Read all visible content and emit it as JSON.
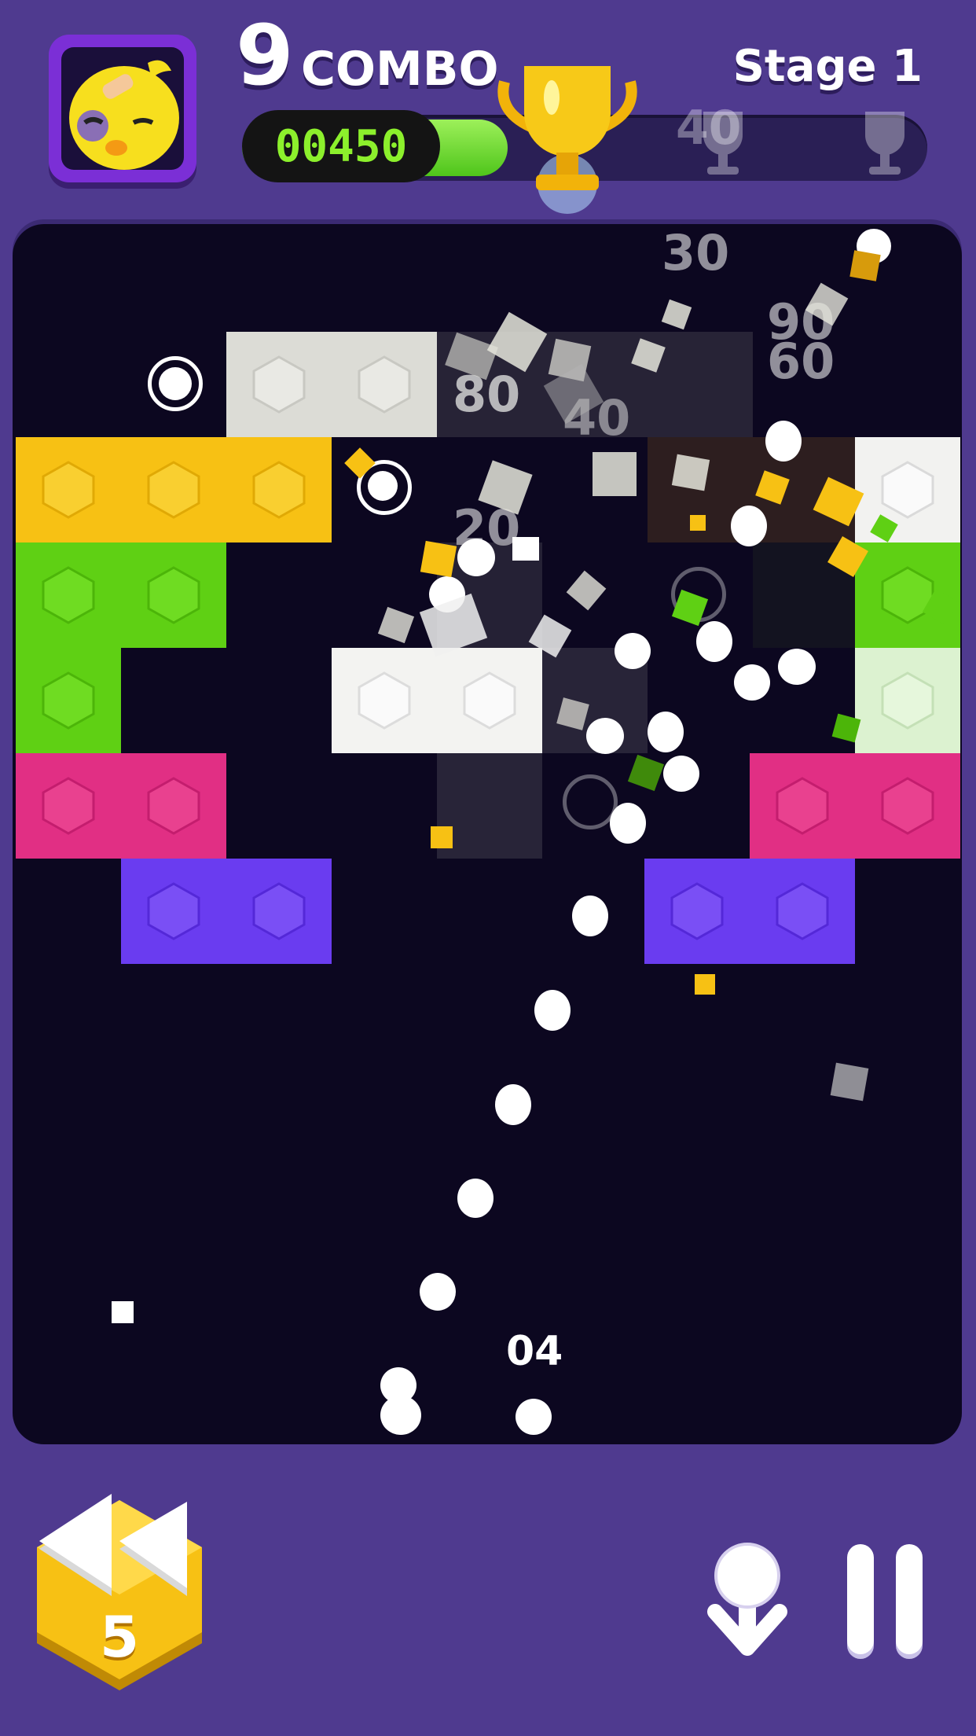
{
  "hud": {
    "combo_count": "9",
    "combo_label": "COMBO",
    "stage_label": "Stage 1",
    "score": "00450",
    "score_progress": 0.25,
    "milestones": [
      "40"
    ]
  },
  "board": {
    "floating_scores": [
      "30",
      "90",
      "60",
      "80",
      "40",
      "20"
    ],
    "ball_count": "04"
  },
  "controls": {
    "rewind_count": "5"
  },
  "colors": {
    "background": "#4f3a8f",
    "board": "#0c0720",
    "yellow": "#f7c114",
    "green": "#5fd014",
    "pink": "#e12f84",
    "purple": "#6a3cf0",
    "white": "#f0f0f0",
    "score_text": "#8cf02c"
  },
  "icons": [
    "chick-avatar-icon",
    "trophy-icon",
    "rewind-icon",
    "drop-arrow-icon",
    "pause-icon"
  ]
}
